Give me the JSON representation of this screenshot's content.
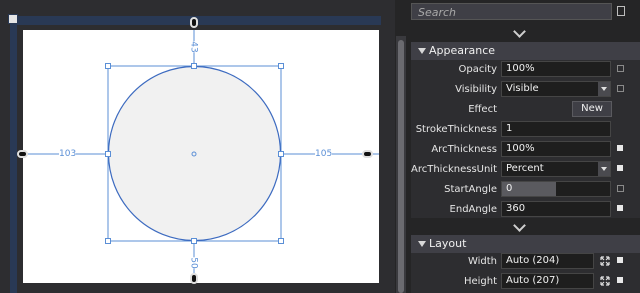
{
  "design_surface": {
    "margin_top": "43",
    "margin_left": "103",
    "margin_right": "105",
    "margin_bottom": "50"
  },
  "properties": {
    "search_placeholder": "Search",
    "appearance": {
      "title": "Appearance",
      "rows": [
        {
          "label": "Opacity",
          "value": "100%"
        },
        {
          "label": "Visibility",
          "value": "Visible"
        },
        {
          "label": "Effect",
          "button": "New"
        },
        {
          "label": "StrokeThickness",
          "value": "1"
        },
        {
          "label": "ArcThickness",
          "value": "100%"
        },
        {
          "label": "ArcThicknessUnit",
          "value": "Percent"
        },
        {
          "label": "StartAngle",
          "value": "0"
        },
        {
          "label": "EndAngle",
          "value": "360"
        }
      ]
    },
    "layout": {
      "title": "Layout",
      "rows": [
        {
          "label": "Width",
          "value": "Auto (204)"
        },
        {
          "label": "Height",
          "value": "Auto (207)"
        }
      ]
    }
  }
}
